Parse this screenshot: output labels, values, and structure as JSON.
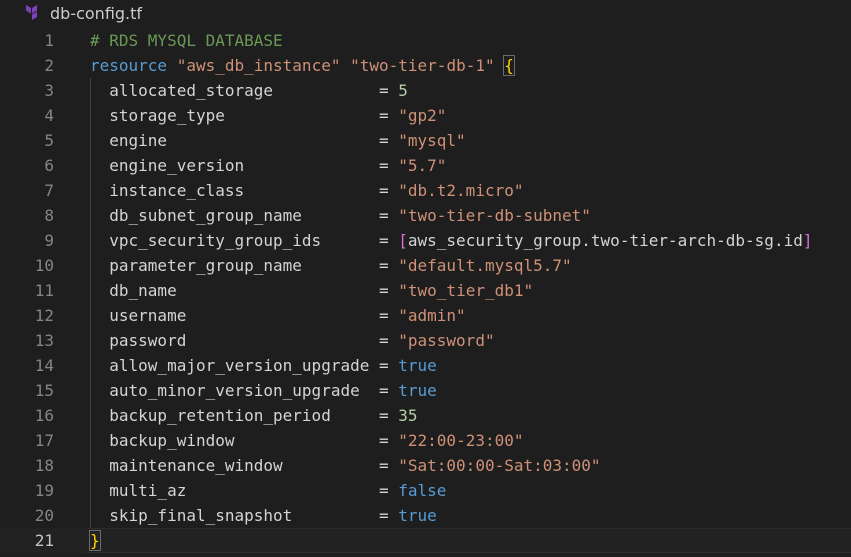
{
  "tab": {
    "file_name": "db-config.tf",
    "file_icon": "terraform-icon",
    "icon_color": "#7b42bc"
  },
  "colors": {
    "background": "#1e1e1e",
    "comment": "#6a9955",
    "keyword": "#569cd6",
    "string": "#ce9178",
    "number": "#b5cea8",
    "property": "#d4d4d4",
    "brace": "#ffd700",
    "square_bracket": "#da70d6",
    "line_number": "#858585"
  },
  "editor": {
    "active_line": 21,
    "lines": [
      {
        "n": "1",
        "comment": "# RDS MYSQL DATABASE"
      },
      {
        "n": "2",
        "keyword": "resource",
        "type": "\"aws_db_instance\"",
        "name": "\"two-tier-db-1\"",
        "open": "{"
      },
      {
        "n": "3",
        "key": "allocated_storage",
        "pad": "           ",
        "eq": "= ",
        "value": "5",
        "vtype": "num"
      },
      {
        "n": "4",
        "key": "storage_type",
        "pad": "                ",
        "eq": "= ",
        "value": "\"gp2\"",
        "vtype": "str"
      },
      {
        "n": "5",
        "key": "engine",
        "pad": "                      ",
        "eq": "= ",
        "value": "\"mysql\"",
        "vtype": "str"
      },
      {
        "n": "6",
        "key": "engine_version",
        "pad": "              ",
        "eq": "= ",
        "value": "\"5.7\"",
        "vtype": "str"
      },
      {
        "n": "7",
        "key": "instance_class",
        "pad": "              ",
        "eq": "= ",
        "value": "\"db.t2.micro\"",
        "vtype": "str"
      },
      {
        "n": "8",
        "key": "db_subnet_group_name",
        "pad": "        ",
        "eq": "= ",
        "value": "\"two-tier-db-subnet\"",
        "vtype": "str"
      },
      {
        "n": "9",
        "key": "vpc_security_group_ids",
        "pad": "      ",
        "eq": "= ",
        "lb": "[",
        "value": "aws_security_group.two-tier-arch-db-sg.id",
        "rb": "]",
        "vtype": "list"
      },
      {
        "n": "10",
        "key": "parameter_group_name",
        "pad": "        ",
        "eq": "= ",
        "value": "\"default.mysql5.7\"",
        "vtype": "str"
      },
      {
        "n": "11",
        "key": "db_name",
        "pad": "                     ",
        "eq": "= ",
        "value": "\"two_tier_db1\"",
        "vtype": "str"
      },
      {
        "n": "12",
        "key": "username",
        "pad": "                    ",
        "eq": "= ",
        "value": "\"admin\"",
        "vtype": "str"
      },
      {
        "n": "13",
        "key": "password",
        "pad": "                    ",
        "eq": "= ",
        "value": "\"password\"",
        "vtype": "str"
      },
      {
        "n": "14",
        "key": "allow_major_version_upgrade",
        "pad": " ",
        "eq": "= ",
        "value": "true",
        "vtype": "bool"
      },
      {
        "n": "15",
        "key": "auto_minor_version_upgrade",
        "pad": "  ",
        "eq": "= ",
        "value": "true",
        "vtype": "bool"
      },
      {
        "n": "16",
        "key": "backup_retention_period",
        "pad": "     ",
        "eq": "= ",
        "value": "35",
        "vtype": "num"
      },
      {
        "n": "17",
        "key": "backup_window",
        "pad": "               ",
        "eq": "= ",
        "value": "\"22:00-23:00\"",
        "vtype": "str"
      },
      {
        "n": "18",
        "key": "maintenance_window",
        "pad": "          ",
        "eq": "= ",
        "value": "\"Sat:00:00-Sat:03:00\"",
        "vtype": "str"
      },
      {
        "n": "19",
        "key": "multi_az",
        "pad": "                    ",
        "eq": "= ",
        "value": "false",
        "vtype": "bool"
      },
      {
        "n": "20",
        "key": "skip_final_snapshot",
        "pad": "         ",
        "eq": "= ",
        "value": "true",
        "vtype": "bool"
      },
      {
        "n": "21",
        "close": "}"
      }
    ]
  }
}
